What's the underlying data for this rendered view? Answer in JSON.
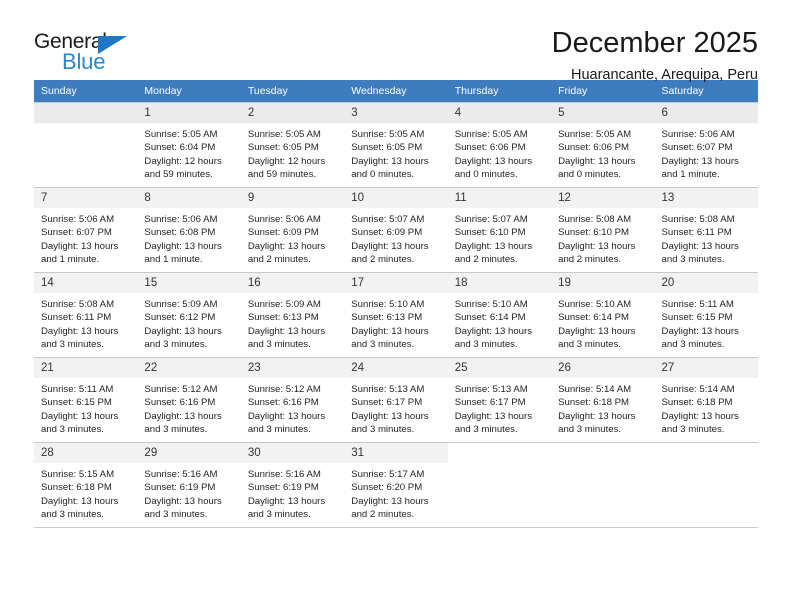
{
  "logo": {
    "text_primary": "General",
    "text_secondary": "Blue",
    "triangle_color": "#1f77c4",
    "secondary_color": "#2a87d0"
  },
  "header": {
    "title": "December 2025",
    "subtitle": "Huarancante, Arequipa, Peru"
  },
  "theme": {
    "header_row_bg": "#3d7cbf",
    "header_row_text": "#ffffff",
    "daynum_bg": "#f2f2f2",
    "grid_line": "#c8c8c8"
  },
  "weekdays": [
    "Sunday",
    "Monday",
    "Tuesday",
    "Wednesday",
    "Thursday",
    "Friday",
    "Saturday"
  ],
  "weeks": [
    [
      {
        "day": "",
        "sunrise": "",
        "sunset": "",
        "daylight1": "",
        "daylight2": "",
        "empty": true
      },
      {
        "day": "1",
        "sunrise": "Sunrise: 5:05 AM",
        "sunset": "Sunset: 6:04 PM",
        "daylight1": "Daylight: 12 hours",
        "daylight2": "and 59 minutes."
      },
      {
        "day": "2",
        "sunrise": "Sunrise: 5:05 AM",
        "sunset": "Sunset: 6:05 PM",
        "daylight1": "Daylight: 12 hours",
        "daylight2": "and 59 minutes."
      },
      {
        "day": "3",
        "sunrise": "Sunrise: 5:05 AM",
        "sunset": "Sunset: 6:05 PM",
        "daylight1": "Daylight: 13 hours",
        "daylight2": "and 0 minutes."
      },
      {
        "day": "4",
        "sunrise": "Sunrise: 5:05 AM",
        "sunset": "Sunset: 6:06 PM",
        "daylight1": "Daylight: 13 hours",
        "daylight2": "and 0 minutes."
      },
      {
        "day": "5",
        "sunrise": "Sunrise: 5:05 AM",
        "sunset": "Sunset: 6:06 PM",
        "daylight1": "Daylight: 13 hours",
        "daylight2": "and 0 minutes."
      },
      {
        "day": "6",
        "sunrise": "Sunrise: 5:06 AM",
        "sunset": "Sunset: 6:07 PM",
        "daylight1": "Daylight: 13 hours",
        "daylight2": "and 1 minute."
      }
    ],
    [
      {
        "day": "7",
        "sunrise": "Sunrise: 5:06 AM",
        "sunset": "Sunset: 6:07 PM",
        "daylight1": "Daylight: 13 hours",
        "daylight2": "and 1 minute."
      },
      {
        "day": "8",
        "sunrise": "Sunrise: 5:06 AM",
        "sunset": "Sunset: 6:08 PM",
        "daylight1": "Daylight: 13 hours",
        "daylight2": "and 1 minute."
      },
      {
        "day": "9",
        "sunrise": "Sunrise: 5:06 AM",
        "sunset": "Sunset: 6:09 PM",
        "daylight1": "Daylight: 13 hours",
        "daylight2": "and 2 minutes."
      },
      {
        "day": "10",
        "sunrise": "Sunrise: 5:07 AM",
        "sunset": "Sunset: 6:09 PM",
        "daylight1": "Daylight: 13 hours",
        "daylight2": "and 2 minutes."
      },
      {
        "day": "11",
        "sunrise": "Sunrise: 5:07 AM",
        "sunset": "Sunset: 6:10 PM",
        "daylight1": "Daylight: 13 hours",
        "daylight2": "and 2 minutes."
      },
      {
        "day": "12",
        "sunrise": "Sunrise: 5:08 AM",
        "sunset": "Sunset: 6:10 PM",
        "daylight1": "Daylight: 13 hours",
        "daylight2": "and 2 minutes."
      },
      {
        "day": "13",
        "sunrise": "Sunrise: 5:08 AM",
        "sunset": "Sunset: 6:11 PM",
        "daylight1": "Daylight: 13 hours",
        "daylight2": "and 3 minutes."
      }
    ],
    [
      {
        "day": "14",
        "sunrise": "Sunrise: 5:08 AM",
        "sunset": "Sunset: 6:11 PM",
        "daylight1": "Daylight: 13 hours",
        "daylight2": "and 3 minutes."
      },
      {
        "day": "15",
        "sunrise": "Sunrise: 5:09 AM",
        "sunset": "Sunset: 6:12 PM",
        "daylight1": "Daylight: 13 hours",
        "daylight2": "and 3 minutes."
      },
      {
        "day": "16",
        "sunrise": "Sunrise: 5:09 AM",
        "sunset": "Sunset: 6:13 PM",
        "daylight1": "Daylight: 13 hours",
        "daylight2": "and 3 minutes."
      },
      {
        "day": "17",
        "sunrise": "Sunrise: 5:10 AM",
        "sunset": "Sunset: 6:13 PM",
        "daylight1": "Daylight: 13 hours",
        "daylight2": "and 3 minutes."
      },
      {
        "day": "18",
        "sunrise": "Sunrise: 5:10 AM",
        "sunset": "Sunset: 6:14 PM",
        "daylight1": "Daylight: 13 hours",
        "daylight2": "and 3 minutes."
      },
      {
        "day": "19",
        "sunrise": "Sunrise: 5:10 AM",
        "sunset": "Sunset: 6:14 PM",
        "daylight1": "Daylight: 13 hours",
        "daylight2": "and 3 minutes."
      },
      {
        "day": "20",
        "sunrise": "Sunrise: 5:11 AM",
        "sunset": "Sunset: 6:15 PM",
        "daylight1": "Daylight: 13 hours",
        "daylight2": "and 3 minutes."
      }
    ],
    [
      {
        "day": "21",
        "sunrise": "Sunrise: 5:11 AM",
        "sunset": "Sunset: 6:15 PM",
        "daylight1": "Daylight: 13 hours",
        "daylight2": "and 3 minutes."
      },
      {
        "day": "22",
        "sunrise": "Sunrise: 5:12 AM",
        "sunset": "Sunset: 6:16 PM",
        "daylight1": "Daylight: 13 hours",
        "daylight2": "and 3 minutes."
      },
      {
        "day": "23",
        "sunrise": "Sunrise: 5:12 AM",
        "sunset": "Sunset: 6:16 PM",
        "daylight1": "Daylight: 13 hours",
        "daylight2": "and 3 minutes."
      },
      {
        "day": "24",
        "sunrise": "Sunrise: 5:13 AM",
        "sunset": "Sunset: 6:17 PM",
        "daylight1": "Daylight: 13 hours",
        "daylight2": "and 3 minutes."
      },
      {
        "day": "25",
        "sunrise": "Sunrise: 5:13 AM",
        "sunset": "Sunset: 6:17 PM",
        "daylight1": "Daylight: 13 hours",
        "daylight2": "and 3 minutes."
      },
      {
        "day": "26",
        "sunrise": "Sunrise: 5:14 AM",
        "sunset": "Sunset: 6:18 PM",
        "daylight1": "Daylight: 13 hours",
        "daylight2": "and 3 minutes."
      },
      {
        "day": "27",
        "sunrise": "Sunrise: 5:14 AM",
        "sunset": "Sunset: 6:18 PM",
        "daylight1": "Daylight: 13 hours",
        "daylight2": "and 3 minutes."
      }
    ],
    [
      {
        "day": "28",
        "sunrise": "Sunrise: 5:15 AM",
        "sunset": "Sunset: 6:18 PM",
        "daylight1": "Daylight: 13 hours",
        "daylight2": "and 3 minutes."
      },
      {
        "day": "29",
        "sunrise": "Sunrise: 5:16 AM",
        "sunset": "Sunset: 6:19 PM",
        "daylight1": "Daylight: 13 hours",
        "daylight2": "and 3 minutes."
      },
      {
        "day": "30",
        "sunrise": "Sunrise: 5:16 AM",
        "sunset": "Sunset: 6:19 PM",
        "daylight1": "Daylight: 13 hours",
        "daylight2": "and 3 minutes."
      },
      {
        "day": "31",
        "sunrise": "Sunrise: 5:17 AM",
        "sunset": "Sunset: 6:20 PM",
        "daylight1": "Daylight: 13 hours",
        "daylight2": "and 2 minutes."
      },
      {
        "day": "",
        "sunrise": "",
        "sunset": "",
        "daylight1": "",
        "daylight2": "",
        "blank": true
      },
      {
        "day": "",
        "sunrise": "",
        "sunset": "",
        "daylight1": "",
        "daylight2": "",
        "blank": true
      },
      {
        "day": "",
        "sunrise": "",
        "sunset": "",
        "daylight1": "",
        "daylight2": "",
        "blank": true
      }
    ]
  ]
}
